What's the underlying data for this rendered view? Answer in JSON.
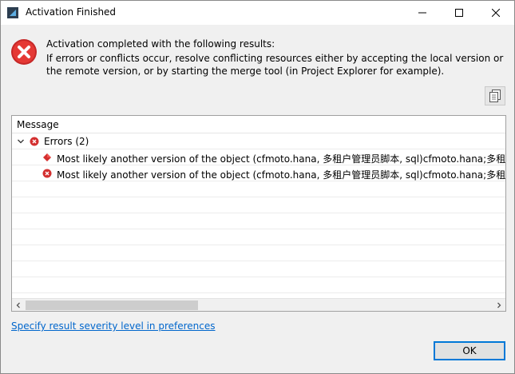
{
  "window": {
    "title": "Activation Finished"
  },
  "message": {
    "line1": "Activation completed with the following results:",
    "line2": "If errors or conflicts occur, resolve conflicting resources either by accepting the local version or",
    "line3": "the remote version, or by starting the merge tool (in Project Explorer for example)."
  },
  "results": {
    "column_header": "Message",
    "group_label": "Errors (2)",
    "items": [
      {
        "text": "Most likely another version of the object (cfmoto.hana, 多租户管理员脚本, sql)cfmoto.hana;多租户管理员脚本",
        "icon": "red-diamond-icon"
      },
      {
        "text": "Most likely another version of the object (cfmoto.hana, 多租户管理员脚本, sql)cfmoto.hana;多租户管理员脚本",
        "icon": "error-circle-icon"
      }
    ]
  },
  "footer": {
    "link_label": "Specify result severity level in preferences",
    "ok_label": "OK"
  },
  "colors": {
    "error_red": "#d32f2f",
    "link_blue": "#0066cc",
    "focus_blue": "#0078d7"
  }
}
